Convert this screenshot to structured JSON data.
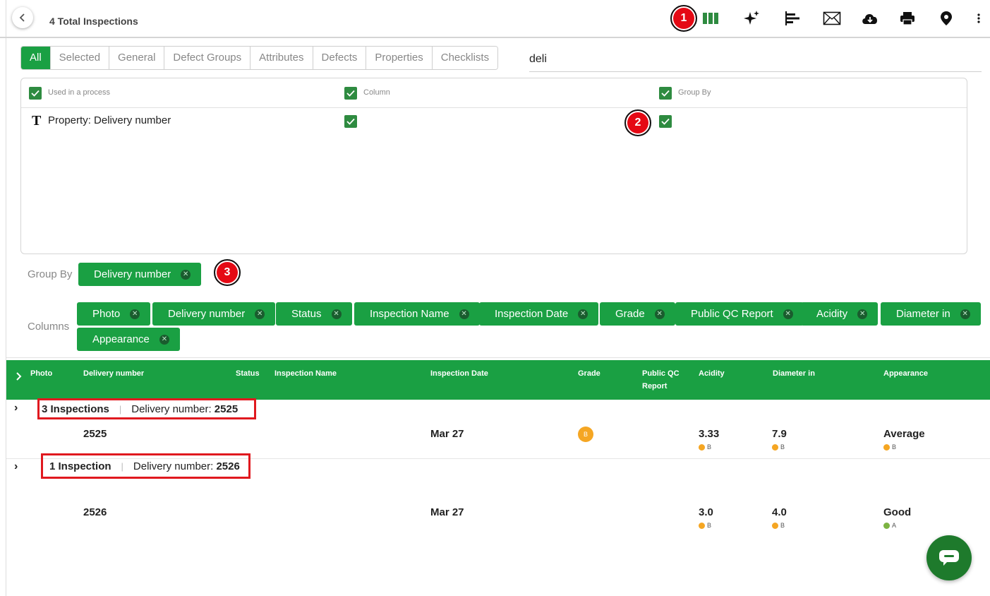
{
  "header": {
    "title": "4 Total Inspections",
    "icons": [
      "columns-icon",
      "sparkle-icon",
      "bar-chart-icon",
      "mail-icon",
      "cloud-download-icon",
      "print-icon",
      "location-pin-icon",
      "more-vert-icon"
    ]
  },
  "markers": {
    "m1": "1",
    "m2": "2",
    "m3": "3"
  },
  "tabs": [
    "All",
    "Selected",
    "General",
    "Defect Groups",
    "Attributes",
    "Defects",
    "Properties",
    "Checklists"
  ],
  "search": {
    "value": "deli"
  },
  "panel": {
    "headers": {
      "used": "Used in a process",
      "column": "Column",
      "groupby": "Group By"
    },
    "row_label": "Property: Delivery number",
    "type_glyph": "T"
  },
  "group_by": {
    "label": "Group By",
    "chips": [
      "Delivery number"
    ]
  },
  "columns": {
    "label": "Columns",
    "chips": [
      "Photo",
      "Delivery number",
      "Status",
      "Inspection Name",
      "Inspection Date",
      "Grade",
      "Public QC Report",
      "Acidity",
      "Diameter in",
      "Appearance"
    ]
  },
  "table": {
    "headers": {
      "photo": "Photo",
      "delivery": "Delivery number",
      "status": "Status",
      "name": "Inspection Name",
      "date": "Inspection Date",
      "grade": "Grade",
      "qc1": "Public QC",
      "qc2": "Report",
      "acidity": "Acidity",
      "diameter": "Diameter in",
      "appearance": "Appearance"
    },
    "groups": [
      {
        "count": "3 Inspections",
        "key_label": "Delivery number:",
        "key_value": "2525",
        "row": {
          "delivery": "2525",
          "date": "Mar 27",
          "grade": "B",
          "acidity": "3.33",
          "acidity_grade": "B",
          "diameter": "7.9",
          "diameter_grade": "B",
          "appearance": "Average",
          "appearance_grade": "B"
        }
      },
      {
        "count": "1 Inspection",
        "key_label": "Delivery number:",
        "key_value": "2526",
        "row": {
          "delivery": "2526",
          "date": "Mar 27",
          "acidity": "3.0",
          "acidity_grade": "B",
          "diameter": "4.0",
          "diameter_grade": "B",
          "appearance": "Good",
          "appearance_grade": "A"
        }
      }
    ]
  },
  "colors": {
    "accent": "#1aa043",
    "marker": "#e50914",
    "grade_b": "#f5a623",
    "grade_a": "#7cb342"
  }
}
